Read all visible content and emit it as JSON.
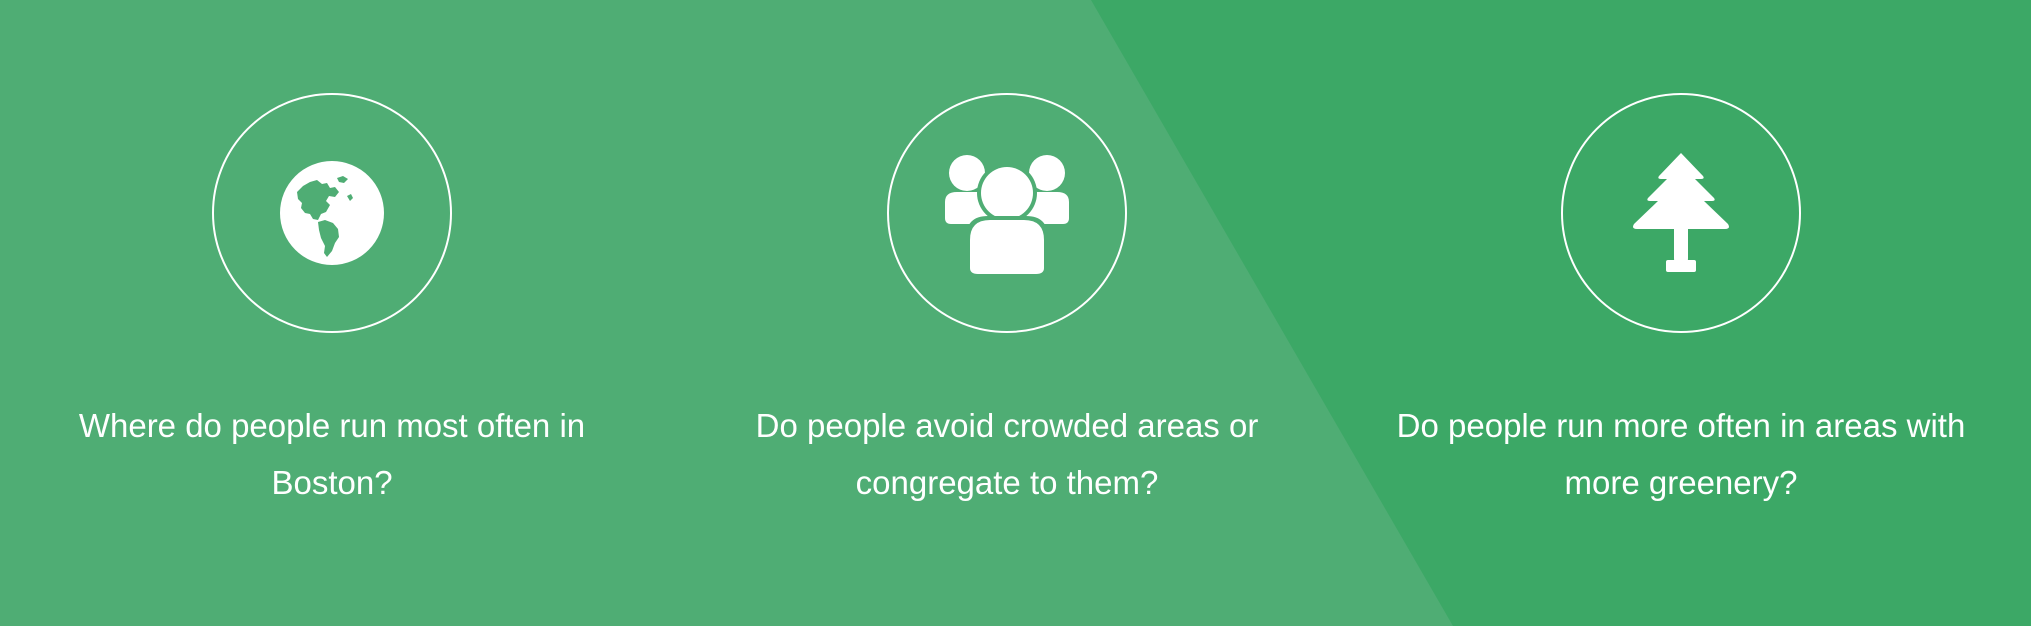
{
  "colors": {
    "background_dark": "#3ca866",
    "background_light": "#4fad74",
    "foreground": "#ffffff"
  },
  "features": [
    {
      "icon": "globe-icon",
      "question": "Where do people run most often in Boston?"
    },
    {
      "icon": "group-people-icon",
      "question": "Do people avoid crowded areas or congregate to them?"
    },
    {
      "icon": "pine-tree-icon",
      "question": "Do people run more often in areas with more greenery?"
    }
  ]
}
